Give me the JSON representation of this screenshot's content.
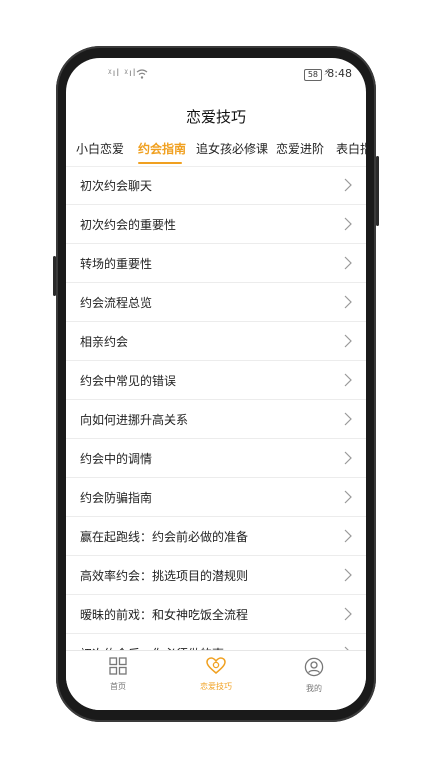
{
  "status": {
    "signal": "ᵡıl ᵡıl",
    "battery": "58",
    "time": "8:48"
  },
  "header": {
    "title": "恋爱技巧"
  },
  "tabs": [
    {
      "label": "小白恋爱"
    },
    {
      "label": "约会指南"
    },
    {
      "label": "追女孩必修课"
    },
    {
      "label": "恋爱进阶"
    },
    {
      "label": "表白指"
    }
  ],
  "active_tab": "约会指南",
  "items": [
    {
      "label": "初次约会聊天"
    },
    {
      "label": "初次约会的重要性"
    },
    {
      "label": "转场的重要性"
    },
    {
      "label": "约会流程总览"
    },
    {
      "label": "相亲约会"
    },
    {
      "label": "约会中常见的错误"
    },
    {
      "label": "向如何进挪升高关系"
    },
    {
      "label": "约会中的调情"
    },
    {
      "label": "约会防骗指南"
    },
    {
      "label": "赢在起跑线：约会前必做的准备"
    },
    {
      "label": "高效率约会：挑选项目的潜规则"
    },
    {
      "label": "暧昧的前戏：和女神吃饭全流程"
    },
    {
      "label": "初次约会后，你必须做的事"
    }
  ],
  "nav": [
    {
      "label": "首页",
      "icon": "grid-icon"
    },
    {
      "label": "恋爱技巧",
      "icon": "heart-icon"
    },
    {
      "label": "我的",
      "icon": "user-icon"
    }
  ],
  "colors": {
    "accent": "#f0a020",
    "text": "#222222",
    "divider": "#ececec"
  }
}
